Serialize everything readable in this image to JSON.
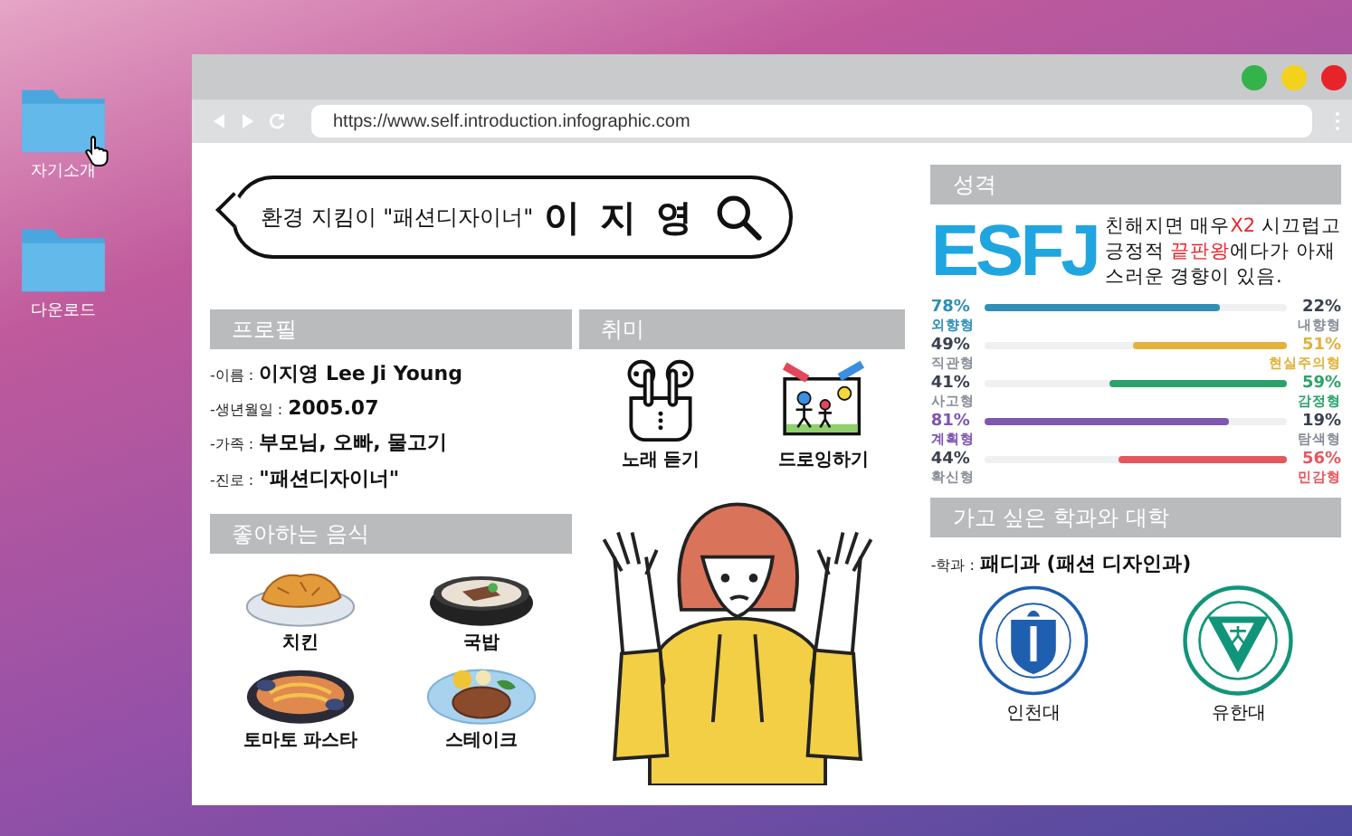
{
  "desktop": {
    "icons": [
      {
        "label": "자기소개",
        "pointer": true
      },
      {
        "label": "다운로드",
        "pointer": false
      }
    ]
  },
  "browser": {
    "url": "https://www.self.introduction.infographic.com"
  },
  "search_bubble": {
    "text": "환경 지킴이 \"패션디자이너\"",
    "name": "이 지 영"
  },
  "profile": {
    "title": "프로필",
    "fields": [
      {
        "label": "-이름 :",
        "value": "이지영 Lee Ji Young"
      },
      {
        "label": "-생년월일 :",
        "value": "2005.07"
      },
      {
        "label": "-가족 :",
        "value": "부모님, 오빠, 물고기"
      },
      {
        "label": "-진로 :",
        "value": "\"패션디자이너\""
      }
    ]
  },
  "hobbies": {
    "title": "취미",
    "items": [
      {
        "kind": "music",
        "label": "노래 듣기"
      },
      {
        "kind": "drawing",
        "label": "드로잉하기"
      }
    ]
  },
  "foods": {
    "title": "좋아하는 음식",
    "items": [
      {
        "kind": "chicken",
        "label": "치킨"
      },
      {
        "kind": "soup",
        "label": "국밥"
      },
      {
        "kind": "pasta",
        "label": "토마토 파스타"
      },
      {
        "kind": "steak",
        "label": "스테이크"
      }
    ]
  },
  "personality": {
    "title": "성격",
    "type": "ESFJ",
    "description": [
      {
        "text": "친해지면 매우",
        "highlight": false
      },
      {
        "text": "X2",
        "highlight": true
      },
      {
        "text": " 시끄럽고 긍정적 ",
        "highlight": false
      },
      {
        "text": "끝판왕",
        "highlight": true
      },
      {
        "text": "에다가 아재스러운 경향이 있음.",
        "highlight": false
      }
    ],
    "traits": [
      {
        "left_percent": "78%",
        "left_label": "외향형",
        "right_percent": "22%",
        "right_label": "내향형",
        "fill_from_right": false,
        "level": 0.78,
        "color": "#2f8fb6"
      },
      {
        "left_percent": "49%",
        "left_label": "직관형",
        "right_percent": "51%",
        "right_label": "현실주의형",
        "fill_from_right": true,
        "level": 0.51,
        "color": "#e3b23c"
      },
      {
        "left_percent": "41%",
        "left_label": "사고형",
        "right_percent": "59%",
        "right_label": "감정형",
        "fill_from_right": true,
        "level": 0.59,
        "color": "#2aa36b"
      },
      {
        "left_percent": "81%",
        "left_label": "계획형",
        "right_percent": "19%",
        "right_label": "탐색형",
        "fill_from_right": false,
        "level": 0.81,
        "color": "#7f56b0"
      },
      {
        "left_percent": "44%",
        "left_label": "확신형",
        "right_percent": "56%",
        "right_label": "민감형",
        "fill_from_right": true,
        "level": 0.56,
        "color": "#e5575f"
      }
    ]
  },
  "university": {
    "title": "가고 싶은 학과와 대학",
    "major_label": "-학과 :",
    "major": "패디과 (패션 디자인과)",
    "schools": [
      {
        "kind": "incheon",
        "name": "인천대"
      },
      {
        "kind": "yuhan",
        "name": "유한대"
      }
    ]
  }
}
